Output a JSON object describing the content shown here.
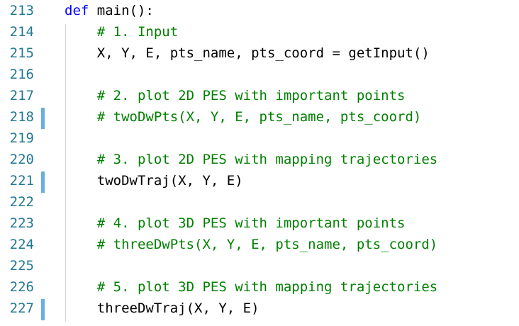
{
  "lines": [
    {
      "num": "213",
      "indent": "",
      "kw": "def",
      "text": " main():",
      "comment": ""
    },
    {
      "num": "214",
      "indent": "    ",
      "comment": "# 1. Input"
    },
    {
      "num": "215",
      "indent": "    ",
      "text": "X, Y, E, pts_name, pts_coord = getInput()"
    },
    {
      "num": "216"
    },
    {
      "num": "217",
      "indent": "    ",
      "comment": "# 2. plot 2D PES with important points"
    },
    {
      "num": "218",
      "indent": "    ",
      "comment": "# twoDwPts(X, Y, E, pts_name, pts_coord)"
    },
    {
      "num": "219"
    },
    {
      "num": "220",
      "indent": "    ",
      "comment": "# 3. plot 2D PES with mapping trajectories"
    },
    {
      "num": "221",
      "indent": "    ",
      "text": "twoDwTraj(X, Y, E)"
    },
    {
      "num": "222"
    },
    {
      "num": "223",
      "indent": "    ",
      "comment": "# 4. plot 3D PES with important points"
    },
    {
      "num": "224",
      "indent": "    ",
      "comment": "# threeDwPts(X, Y, E, pts_name, pts_coord)"
    },
    {
      "num": "225"
    },
    {
      "num": "226",
      "indent": "    ",
      "comment": "# 5. plot 3D PES with mapping trajectories"
    },
    {
      "num": "227",
      "indent": "    ",
      "text": "threeDwTraj(X, Y, E)"
    }
  ],
  "colors": {
    "keyword": "#0000ff",
    "comment": "#008000",
    "line_number": "#237893",
    "modified_marker": "#66afe0"
  }
}
